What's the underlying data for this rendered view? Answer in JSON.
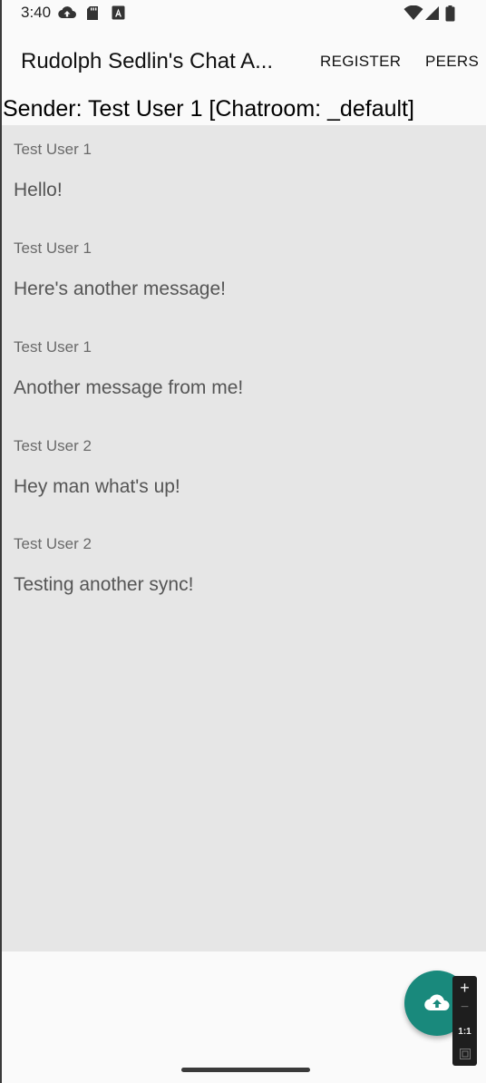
{
  "status_bar": {
    "time": "3:40",
    "left_icons": [
      "cloud-upload-icon",
      "sd-card-icon",
      "font-a-icon"
    ],
    "right_icons": [
      "wifi-icon",
      "cell-signal-icon",
      "battery-icon"
    ]
  },
  "app_bar": {
    "title": "Rudolph Sedlin's Chat A...",
    "actions": {
      "register": "REGISTER",
      "peers": "PEERS"
    }
  },
  "sender_line": "Sender: Test User 1 [Chatroom: _default]",
  "messages": [
    {
      "sender": "Test User 1",
      "text": "Hello!"
    },
    {
      "sender": "Test User 1",
      "text": "Here's another message!"
    },
    {
      "sender": "Test User 1",
      "text": "Another message from me!"
    },
    {
      "sender": "Test User 2",
      "text": "Hey man what's up!"
    },
    {
      "sender": "Test User 2",
      "text": "Testing another sync!"
    }
  ],
  "fab": {
    "icon": "cloud-upload-icon",
    "color": "#19897c"
  },
  "zoom_control": {
    "plus": "+",
    "minus": "−",
    "reset": "1:1",
    "fit_icon": "fit-screen-icon"
  },
  "colors": {
    "message_area": "#e6e6e6",
    "background": "#fafafa"
  }
}
